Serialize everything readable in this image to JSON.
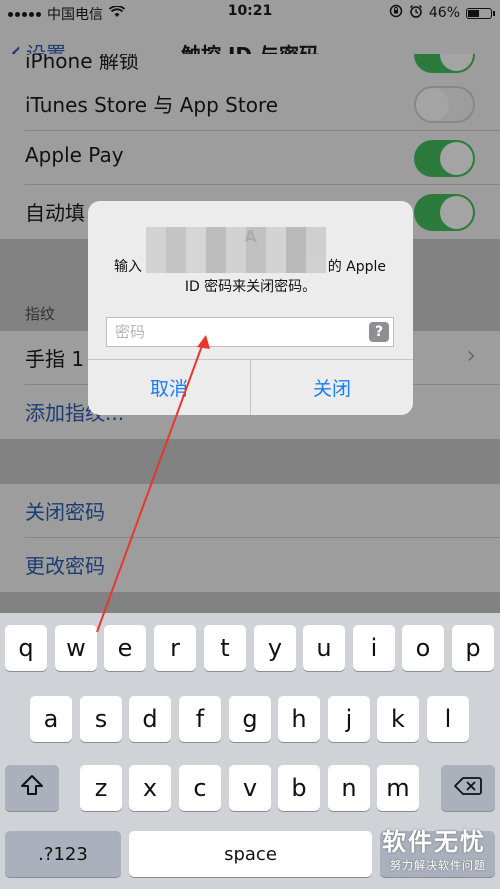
{
  "status_bar": {
    "carrier": "中国电信",
    "time": "10:21",
    "battery_percent": "46%",
    "battery_level": 0.46
  },
  "nav": {
    "back_label": "设置",
    "title": "触控 ID 与密码"
  },
  "settings": {
    "rows_top": [
      {
        "label": "iPhone 解锁",
        "toggle": true
      },
      {
        "label": "iTunes Store 与 App Store",
        "toggle": false
      },
      {
        "label": "Apple Pay",
        "toggle": true
      },
      {
        "label": "自动填",
        "toggle": true
      }
    ],
    "fingerprint_header": "指纹",
    "finger_row": "手指 1",
    "add_fingerprint": "添加指纹...",
    "turn_off_passcode": "关闭密码",
    "change_passcode": "更改密码"
  },
  "dialog": {
    "title_visible": "A",
    "message_prefix": "输入",
    "message_suffix": "的 Apple",
    "message_line2": "ID 密码来关闭密码。",
    "password_placeholder": "密码",
    "help_icon_label": "?",
    "cancel_label": "取消",
    "confirm_label": "关闭",
    "button_color": "#1b7cf5"
  },
  "keyboard": {
    "row1": [
      "q",
      "w",
      "e",
      "r",
      "t",
      "y",
      "u",
      "i",
      "o",
      "p"
    ],
    "row2": [
      "a",
      "s",
      "d",
      "f",
      "g",
      "h",
      "j",
      "k",
      "l"
    ],
    "row3": [
      "z",
      "x",
      "c",
      "v",
      "b",
      "n",
      "m"
    ],
    "numbers_key": ".?123",
    "space_key": "space",
    "shift_icon": "shift-icon",
    "delete_icon": "backspace-icon"
  },
  "watermark": {
    "main": "软件无忧",
    "sub": "努力解决软件问题"
  },
  "annotation": {
    "color": "#e8372c"
  }
}
